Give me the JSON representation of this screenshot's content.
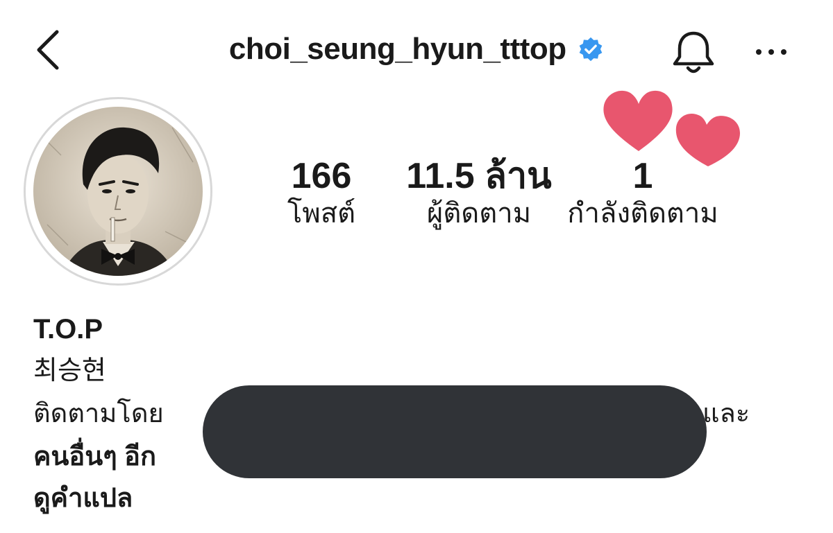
{
  "header": {
    "username": "choi_seung_hyun_tttop",
    "back_icon": "chevron-left-icon",
    "verified_icon": "verified-badge-icon",
    "bell_icon": "bell-icon",
    "more_icon": "more-horizontal-icon",
    "verified_color": "#3897f0"
  },
  "stats": {
    "posts": {
      "value": "166",
      "label": "โพสต์"
    },
    "followers": {
      "value": "11.5 ล้าน",
      "label": "ผู้ติดตาม"
    },
    "following": {
      "value": "1",
      "label": "กำลังติดตาม"
    }
  },
  "decor": {
    "hearts_color": "#e8566e"
  },
  "bio": {
    "name": "T.O.P",
    "korean_name": "최승현",
    "followed_by_prefix": "ติดตามโดย",
    "followed_by_suffix": "และ",
    "others_prefix": "คนอื่นๆ อีก",
    "translate_link": "ดูคำแปล"
  }
}
